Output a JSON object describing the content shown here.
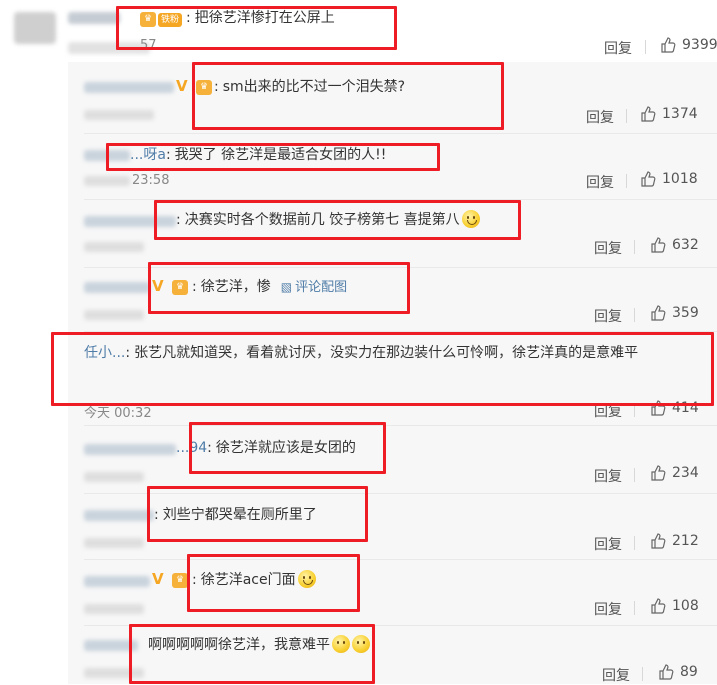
{
  "comments": [
    {
      "text": "把徐艺洋惨打在公屏上",
      "time": "57",
      "reply": "回复",
      "likes": "9399",
      "fan_badge": "铁粉"
    },
    {
      "text": "sm出来的比不过一个泪失禁?",
      "time": "",
      "reply": "回复",
      "likes": "1374"
    },
    {
      "name": "...呀a",
      "text": "我哭了 徐艺洋是最适合女团的人!!",
      "time": "23:58",
      "reply": "回复",
      "likes": "1018"
    },
    {
      "text": "决赛实时各个数据前几  饺子榜第七 喜提第八",
      "time": "",
      "reply": "回复",
      "likes": "632"
    },
    {
      "text": "徐艺洋，惨",
      "image_link": "评论配图",
      "time": "",
      "reply": "回复",
      "likes": "359"
    },
    {
      "name": "任小...",
      "text": "张艺凡就知道哭，看着就讨厌，没实力在那边装什么可怜啊，徐艺洋真的是意难平",
      "time": "今天 00:32",
      "reply": "回复",
      "likes": "414"
    },
    {
      "name": "...94",
      "text": "徐艺洋就应该是女团的",
      "time": "",
      "reply": "回复",
      "likes": "234"
    },
    {
      "text": "刘些宁都哭晕在厕所里了",
      "time": "",
      "reply": "回复",
      "likes": "212"
    },
    {
      "text": "徐艺洋ace门面",
      "time": "",
      "reply": "回复",
      "likes": "108"
    },
    {
      "text": "啊啊啊啊啊徐艺洋，我意难平",
      "time": "",
      "reply": "回复",
      "likes": "89"
    }
  ],
  "colors": {
    "highlight": "#ee1c25",
    "link": "#507da8",
    "panel": "#f7f7f7"
  }
}
